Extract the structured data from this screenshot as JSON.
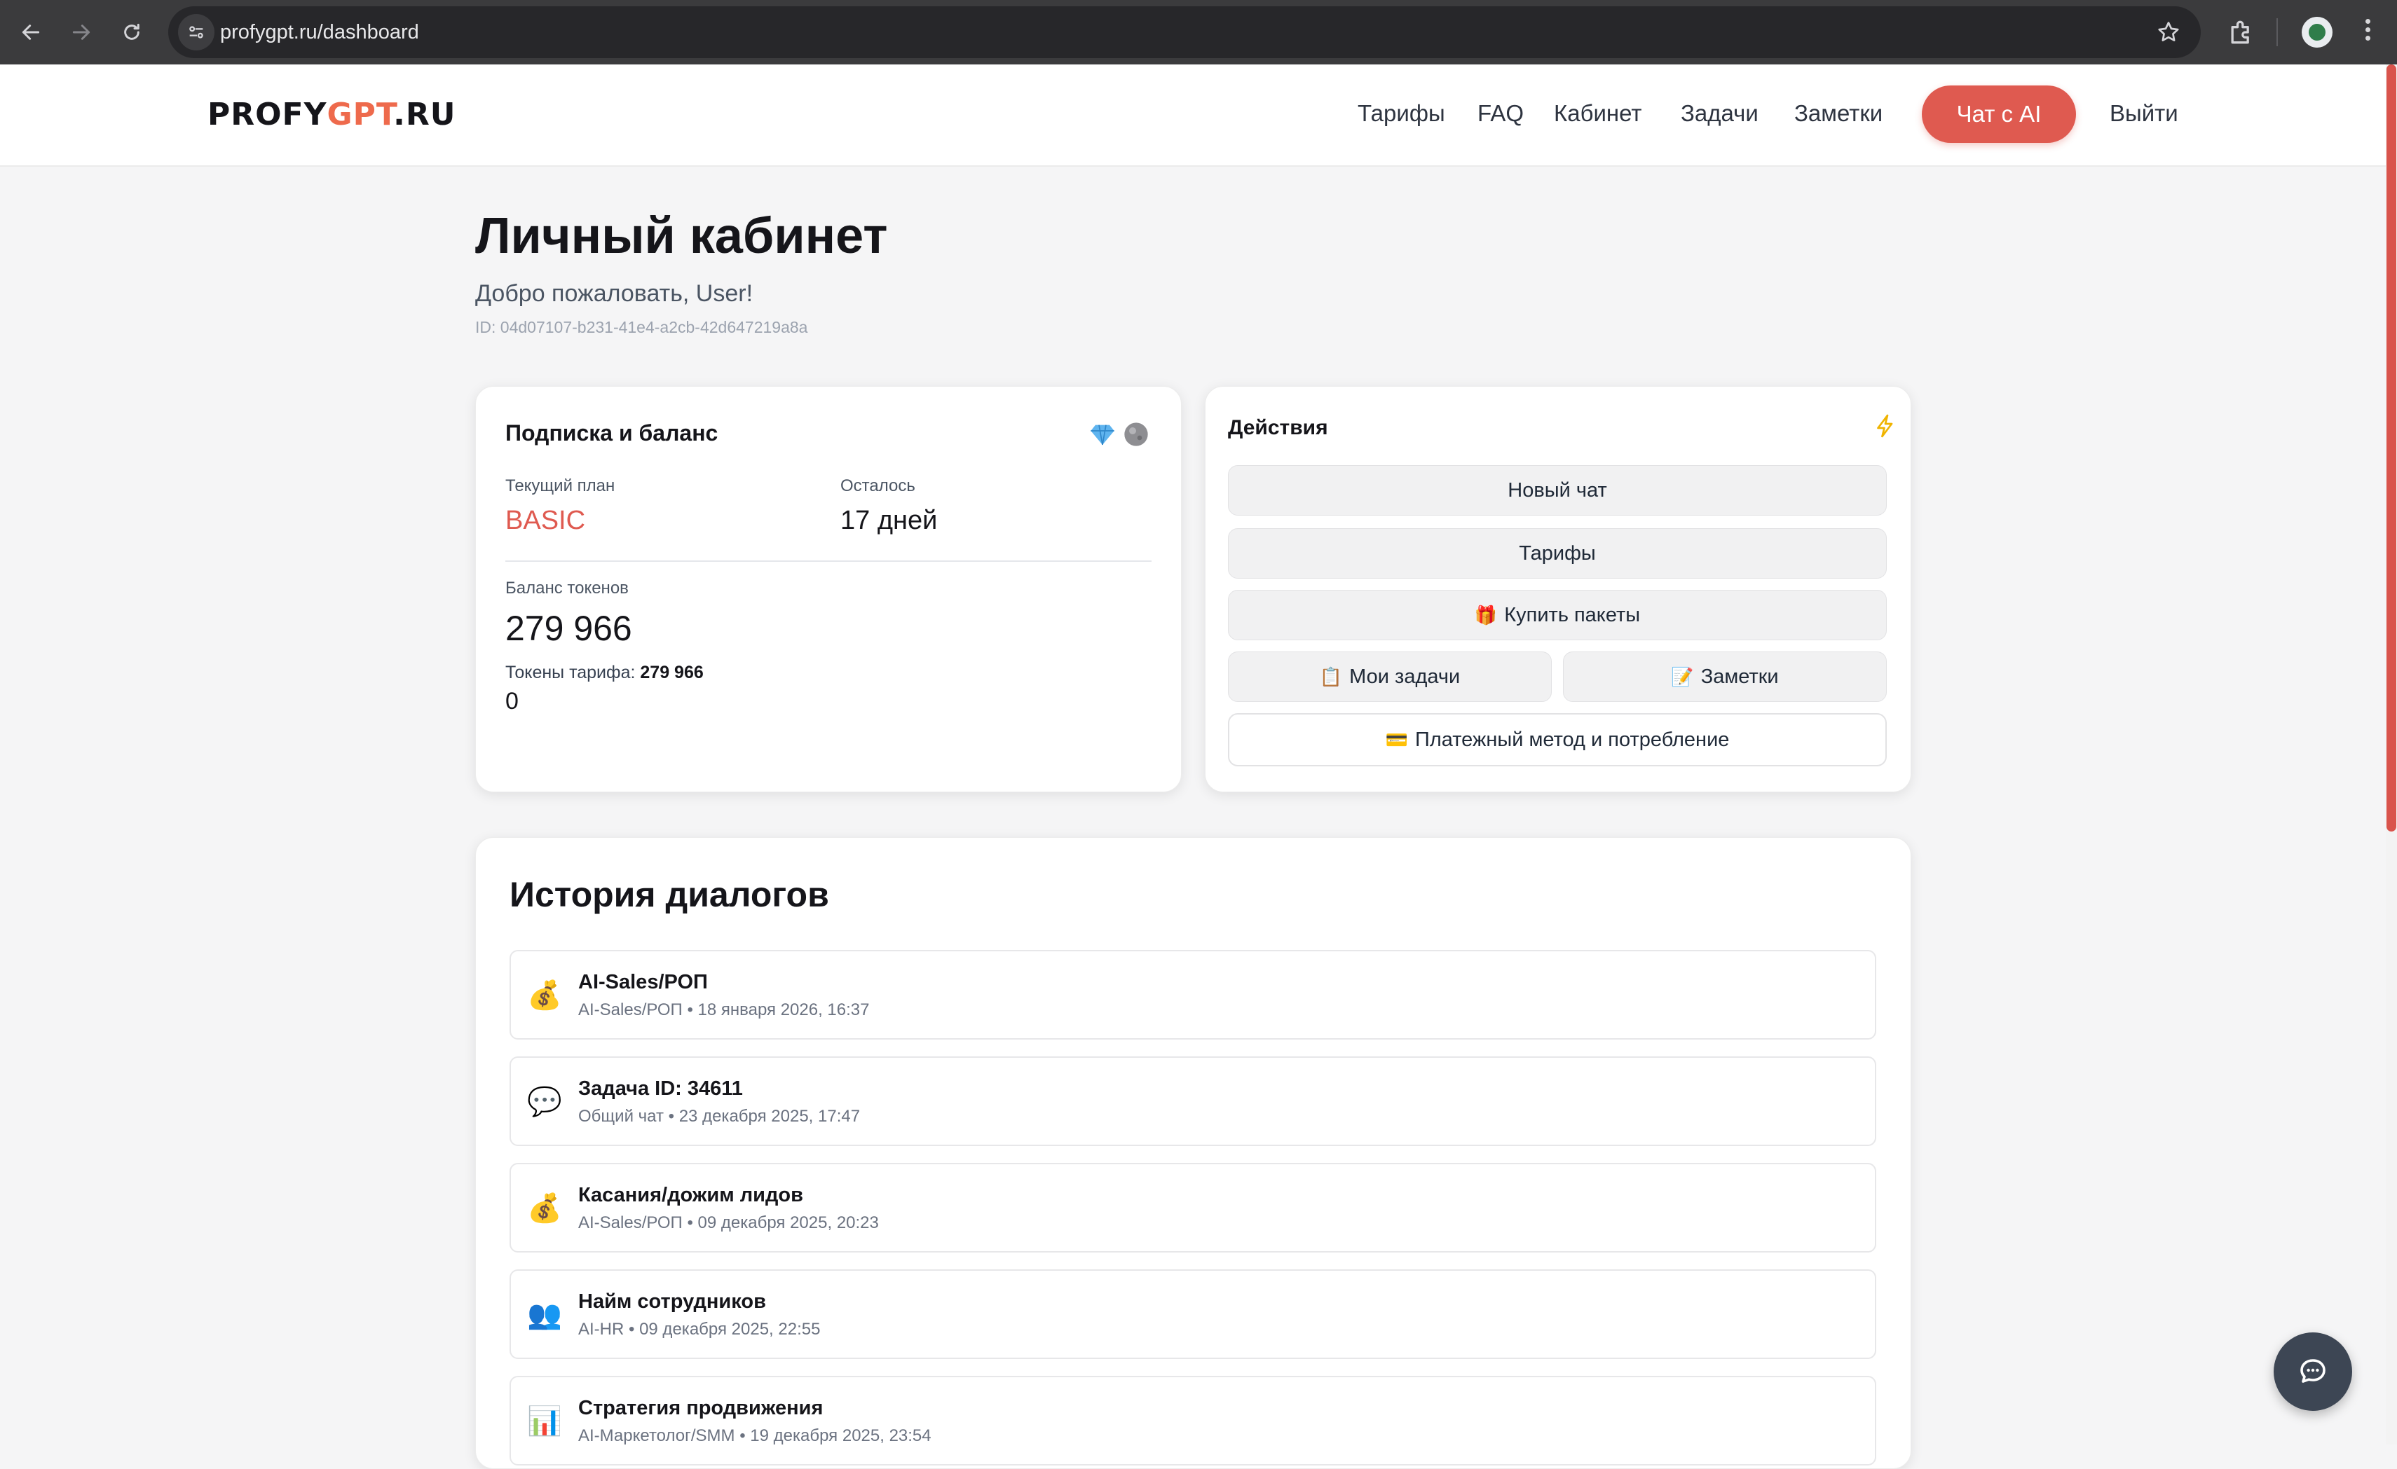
{
  "browser": {
    "url": "profygpt.ru/dashboard"
  },
  "header": {
    "logo_part1": "PROFY",
    "logo_part2": "GPT",
    "logo_part3": ".RU",
    "nav": [
      "Тарифы",
      "FAQ",
      "Кабинет",
      "Задачи",
      "Заметки"
    ],
    "cta": "Чат с AI",
    "logout": "Выйти"
  },
  "page": {
    "title": "Личный кабинет",
    "welcome": "Добро пожаловать, User!",
    "user_id": "ID: 04d07107-b231-41e4-a2cb-42d647219a8a"
  },
  "subscription": {
    "title": "Подписка и баланс",
    "plan_label": "Текущий план",
    "plan_value": "BASIC",
    "remaining_label": "Осталось",
    "remaining_value": "17 дней",
    "balance_label": "Баланс токенов",
    "balance_value": "279 966",
    "tariff_tokens_label": "Токены тарифа:",
    "tariff_tokens_value": "279 966",
    "extra_value": "0"
  },
  "actions": {
    "title": "Действия",
    "new_chat": "Новый чат",
    "tariffs": "Тарифы",
    "buy_packs": "Купить пакеты",
    "my_tasks": "Мои задачи",
    "notes": "Заметки",
    "payment": "Платежный метод и потребление"
  },
  "history": {
    "title": "История диалогов",
    "items": [
      {
        "icon": "money-bag-icon",
        "emoji": "💰",
        "name": "AI-Sales/РОП",
        "meta": "AI-Sales/РОП • 18 января 2026, 16:37"
      },
      {
        "icon": "speech-bubble-icon",
        "emoji": "💬",
        "name": "Задача ID: 34611",
        "meta": "Общий чат • 23 декабря 2025, 17:47"
      },
      {
        "icon": "money-bag-icon",
        "emoji": "💰",
        "name": "Касания/дожим лидов",
        "meta": "AI-Sales/РОП • 09 декабря 2025, 20:23"
      },
      {
        "icon": "people-icon",
        "emoji": "👥",
        "name": "Найм сотрудников",
        "meta": "AI-HR • 09 декабря 2025, 22:55"
      },
      {
        "icon": "bar-chart-icon",
        "emoji": "📊",
        "name": "Стратегия продвижения",
        "meta": "AI-Маркетолог/SMM • 19 декабря 2025, 23:54"
      }
    ]
  },
  "colors": {
    "accent": "#df5a50",
    "logo_accent": "#ee6a4c",
    "fab": "#3d4654"
  }
}
